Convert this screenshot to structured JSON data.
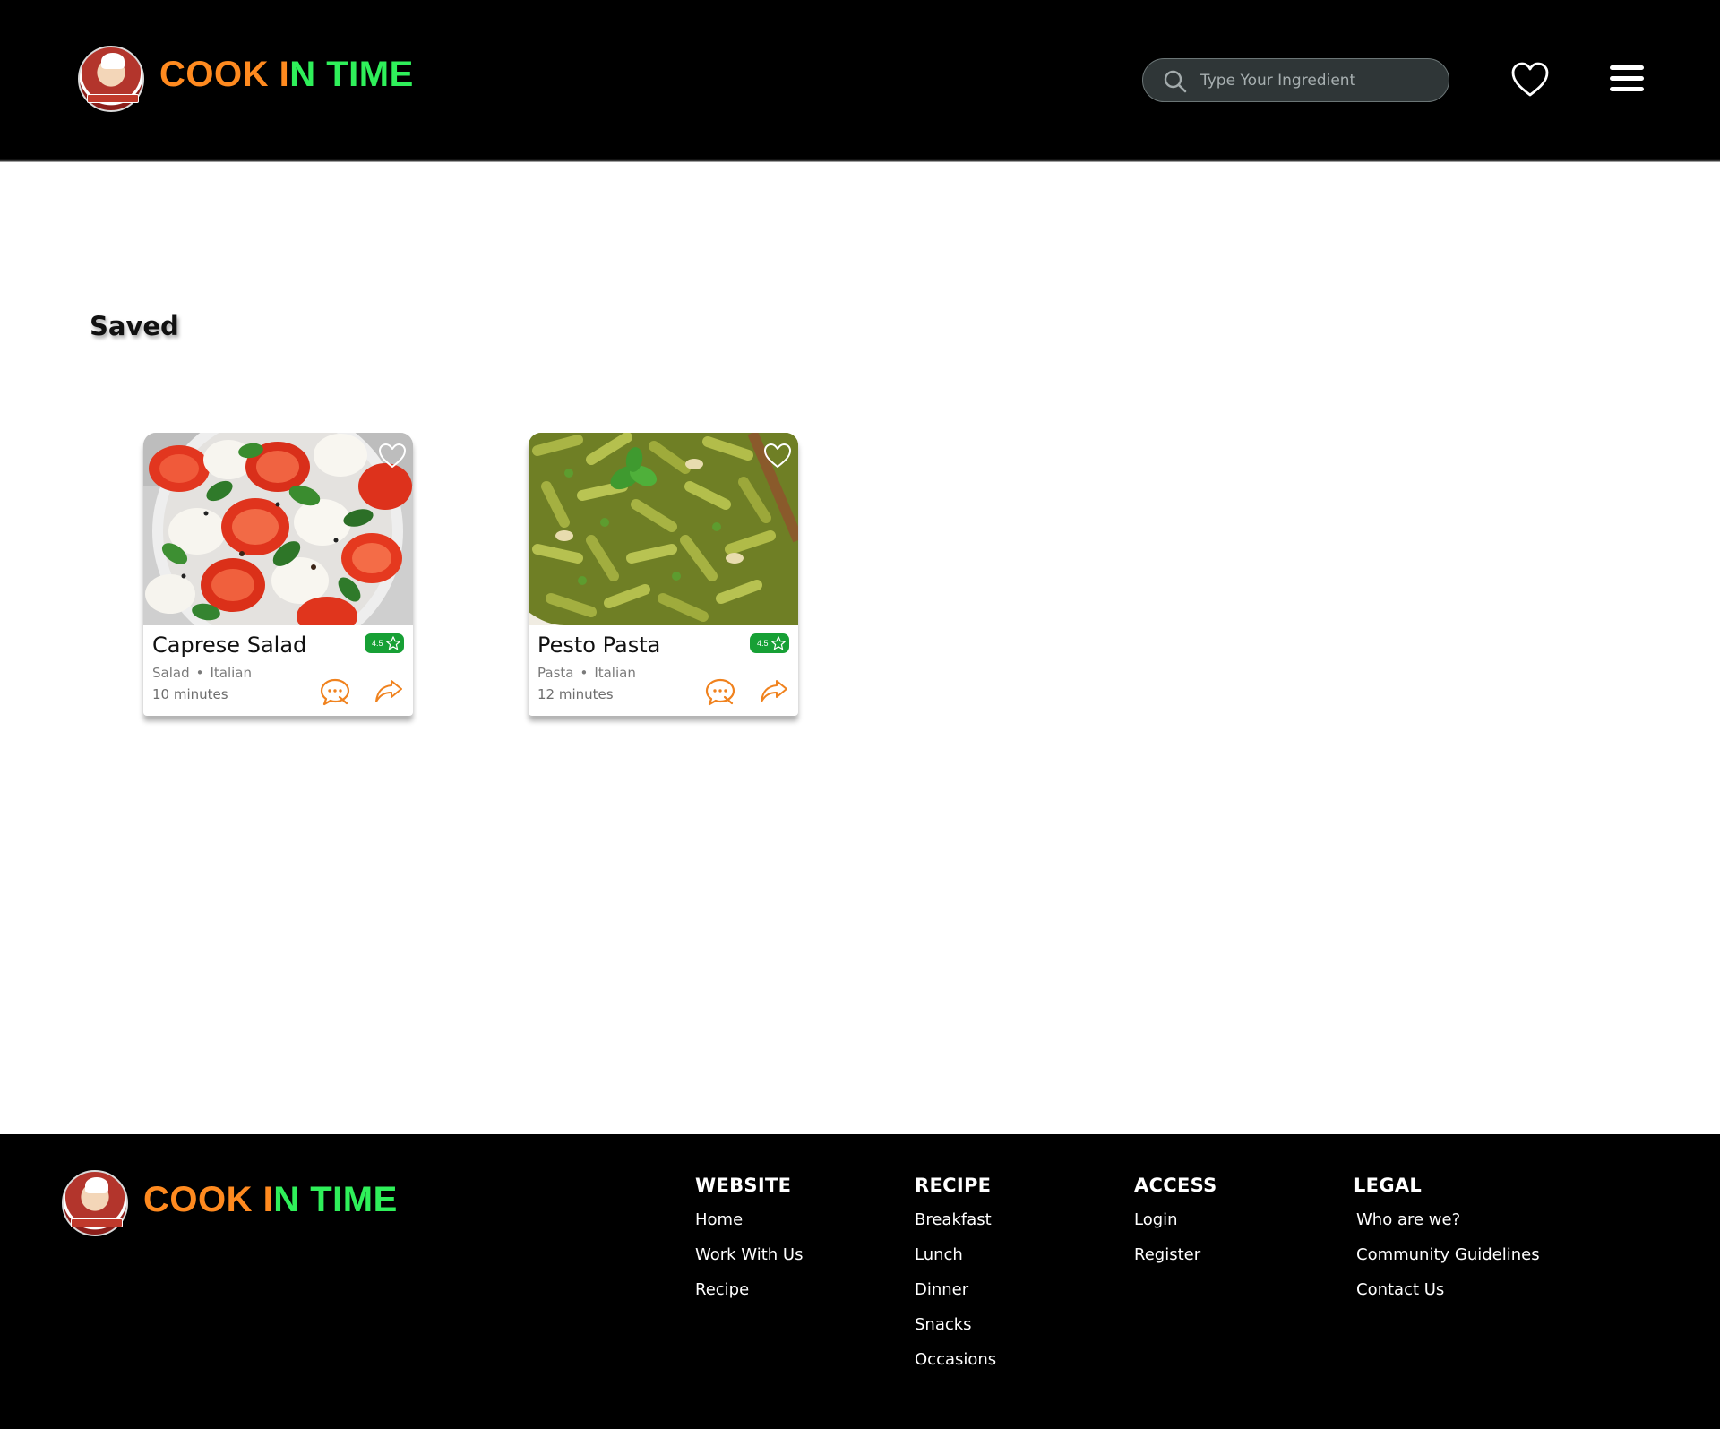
{
  "header": {
    "brand": {
      "part1": "COOK ",
      "part2": "I",
      "part3": "N TIME"
    },
    "search": {
      "placeholder": "Type Your Ingredient",
      "value": ""
    }
  },
  "main": {
    "title": "Saved",
    "cards": [
      {
        "title": "Caprese Salad",
        "rating": "4.5",
        "category": "Salad",
        "cuisine": "Italian",
        "time": "10 minutes"
      },
      {
        "title": "Pesto Pasta",
        "rating": "4.5",
        "category": "Pasta",
        "cuisine": "Italian",
        "time": "12 minutes"
      }
    ]
  },
  "footer": {
    "brand": {
      "part1": "COOK ",
      "part2": "I",
      "part3": "N TIME"
    },
    "columns": [
      {
        "heading": "WEBSITE",
        "links": [
          "Home",
          "Work With Us",
          "Recipe"
        ]
      },
      {
        "heading": "RECIPE",
        "links": [
          "Breakfast",
          "Lunch",
          "Dinner",
          "Snacks",
          "Occasions"
        ]
      },
      {
        "heading": "ACCESS",
        "links": [
          "Login",
          "Register"
        ]
      },
      {
        "heading": "LEGAL",
        "links": [
          "Who are we?",
          "Community Guidelines",
          "Contact Us"
        ]
      }
    ]
  },
  "colors": {
    "brand_orange": "#ff8a1f",
    "brand_green": "#2ff05a",
    "rating_green": "#17a035",
    "action_orange": "#f0821e",
    "header_bg": "#000000",
    "search_bg": "#2f3637"
  },
  "icons": {
    "header": [
      "search-icon",
      "heart-icon",
      "hamburger-menu-icon"
    ],
    "card": [
      "heart-icon",
      "star-icon",
      "chat-icon",
      "share-icon"
    ],
    "logo": "chef-logo-icon"
  }
}
